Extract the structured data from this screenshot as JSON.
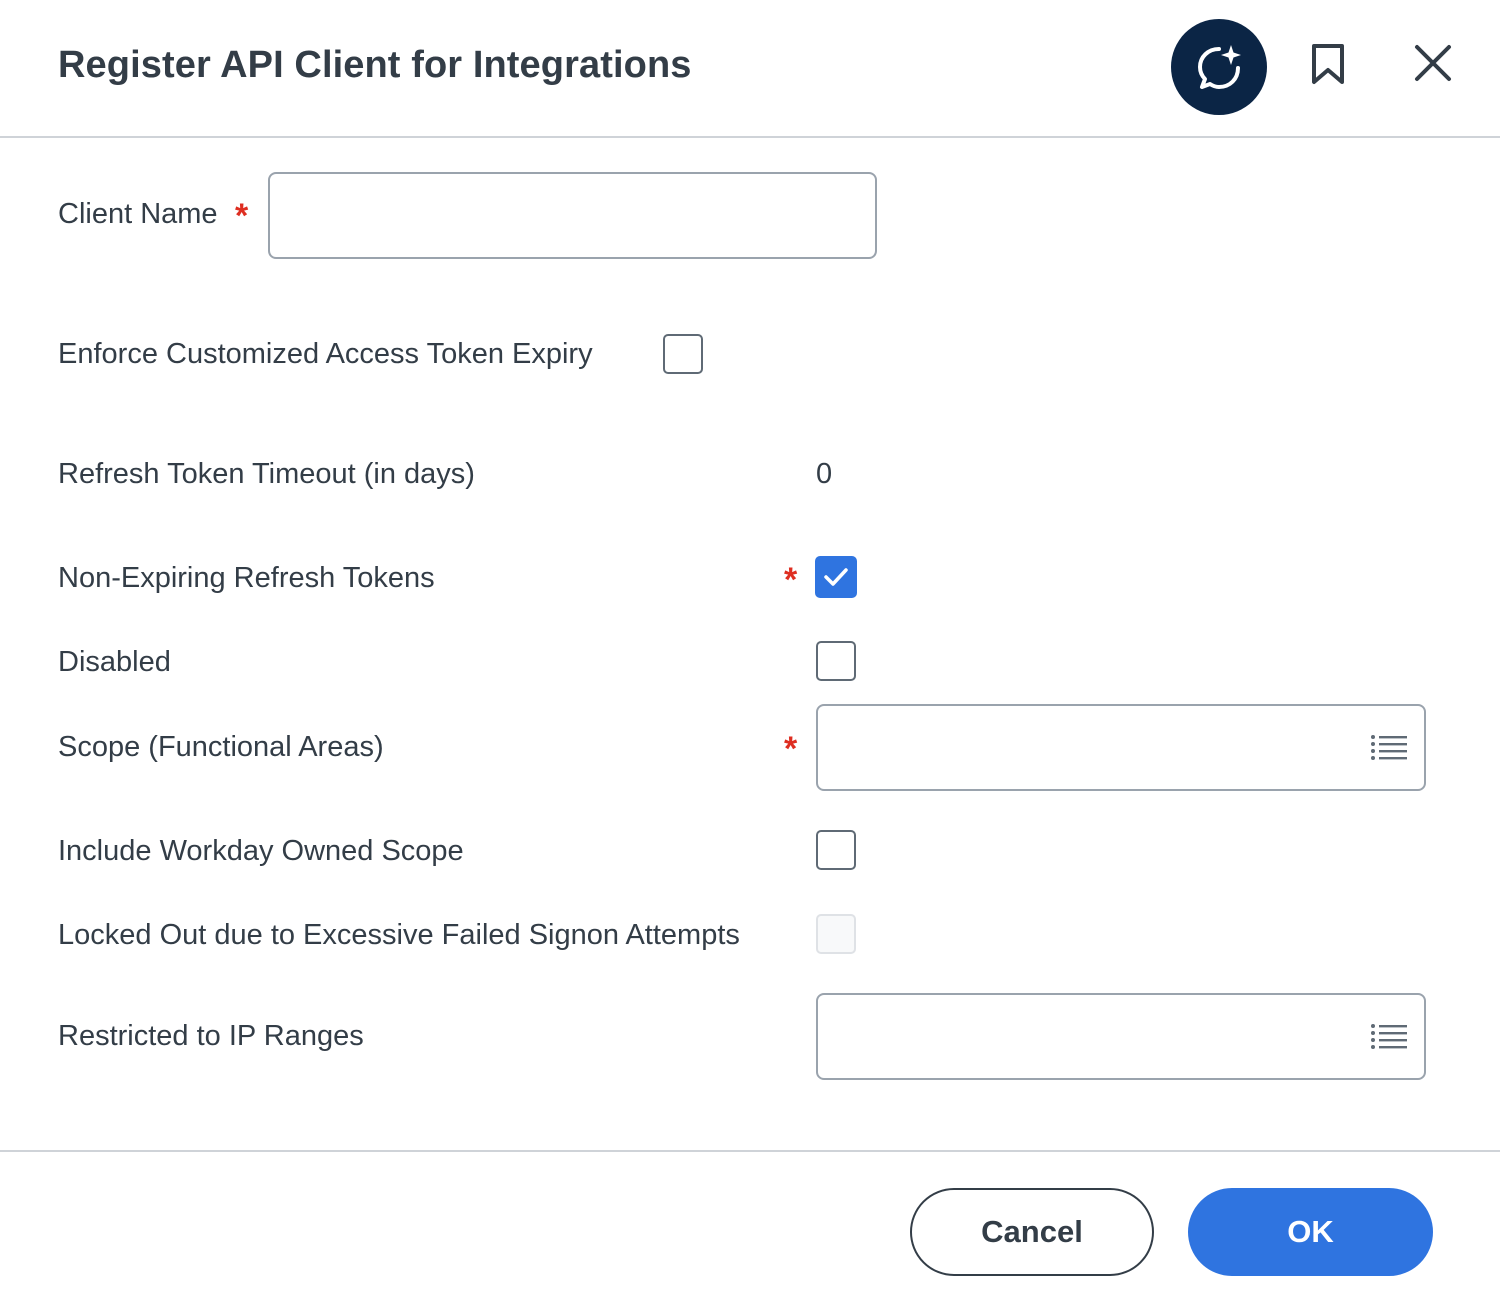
{
  "header": {
    "title": "Register API Client for Integrations",
    "icons": {
      "assistant": "assistant-sparkle-icon",
      "bookmark": "bookmark-icon",
      "close": "close-icon"
    }
  },
  "form": {
    "client_name": {
      "label": "Client Name",
      "required_mark": "*",
      "value": ""
    },
    "enforce_expiry": {
      "label": "Enforce Customized Access Token Expiry",
      "checked": false
    },
    "refresh_timeout": {
      "label": "Refresh Token Timeout (in days)",
      "value": "0"
    },
    "non_expiring": {
      "label": "Non-Expiring Refresh Tokens",
      "required_mark": "*",
      "checked": true
    },
    "disabled": {
      "label": "Disabled",
      "checked": false
    },
    "scope": {
      "label": "Scope (Functional Areas)",
      "required_mark": "*",
      "value": ""
    },
    "include_workday_scope": {
      "label": "Include Workday Owned Scope",
      "checked": false
    },
    "locked_out": {
      "label": "Locked Out due to Excessive Failed Signon Attempts",
      "checked": false,
      "disabled": true
    },
    "ip_ranges": {
      "label": "Restricted to IP Ranges",
      "value": ""
    }
  },
  "footer": {
    "cancel_label": "Cancel",
    "ok_label": "OK"
  },
  "colors": {
    "primary": "#2f74e0",
    "assistant_bg": "#0b2545",
    "required": "#de2e21",
    "text": "#333d47"
  }
}
